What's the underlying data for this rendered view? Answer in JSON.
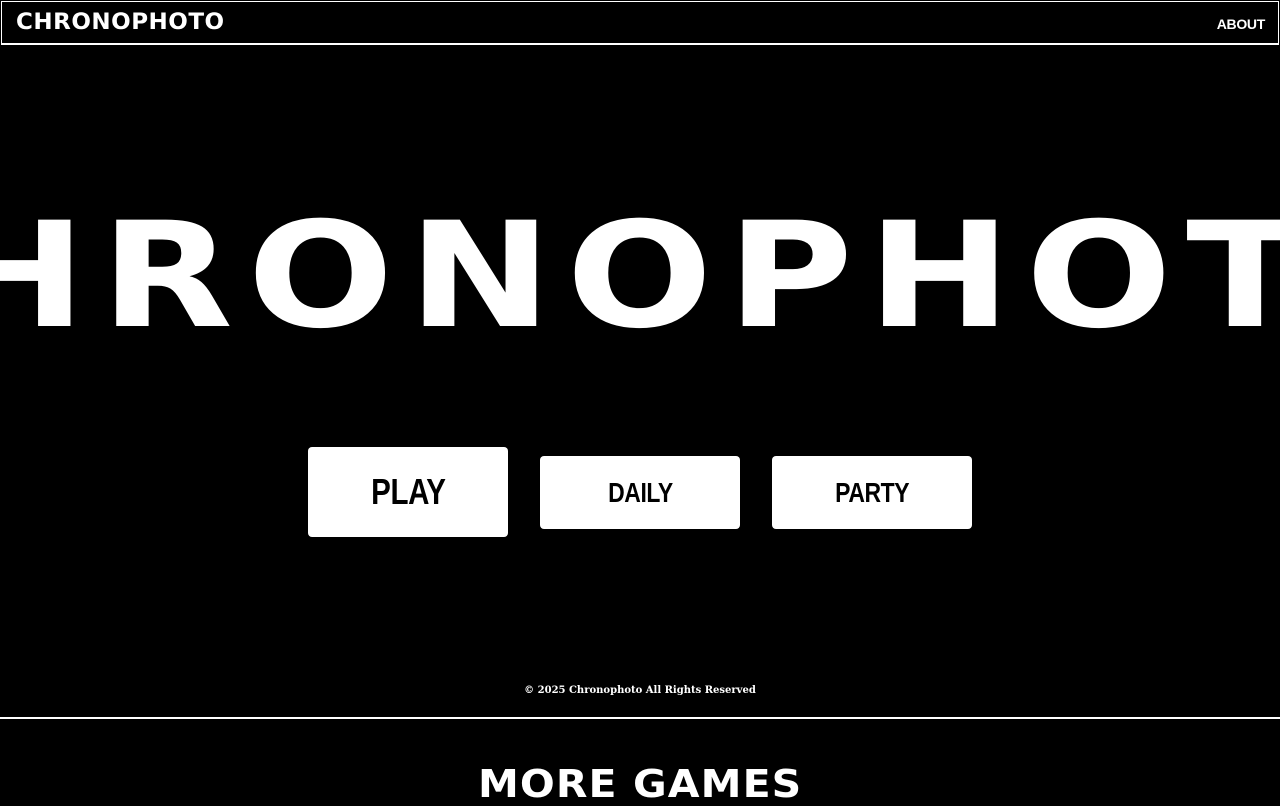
{
  "header": {
    "brand": "CHRONOPHOTO",
    "nav_about": "ABOUT"
  },
  "hero": {
    "title": "CHRONOPHOTO"
  },
  "buttons": {
    "play": "PLAY",
    "daily": "DAILY",
    "party": "PARTY"
  },
  "footer": {
    "copyright": "© 2025 Chronophoto All Rights Reserved"
  },
  "more_games": {
    "heading": "MORE GAMES"
  },
  "colors": {
    "background": "#000000",
    "foreground": "#ffffff"
  }
}
